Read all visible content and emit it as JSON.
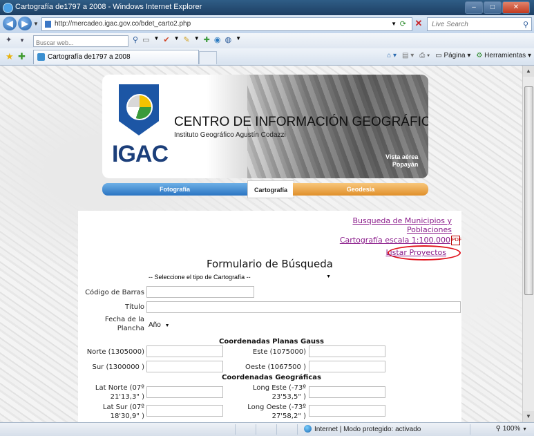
{
  "window": {
    "title": "Cartografía de1797 a 2008 - Windows Internet Explorer",
    "url": "http://mercadeo.igac.gov.co/bdet_carto2.php",
    "search_placeholder": "Live Search",
    "toolbar_search_placeholder": "Buscar web...",
    "tab_label": "Cartografía de1797 a 2008",
    "commands": {
      "pagina": "Página",
      "herramientas": "Herramientas"
    }
  },
  "banner": {
    "logo_text": "IGAC",
    "title": "CENTRO DE INFORMACIÓN GEOGRÁFICA",
    "subtitle": "Instituto Geográfico Agustín Codazzi",
    "aerial_caption_line1": "Vista aérea",
    "aerial_caption_line2": "Popayán"
  },
  "sections": {
    "fotografia": "Fotografía",
    "cartografia": "Cartografía",
    "geodesia": "Geodesia"
  },
  "links": {
    "busqueda": "Busqueda de Municipios y Poblaciones",
    "cartografia_escala": "Cartografía escala 1:100.000",
    "listar_proyectos": "Listar Proyectos"
  },
  "form": {
    "title": "Formulario de Búsqueda",
    "tipo_selected": "-- Seleccione el tipo de Cartografía --",
    "codigo_label": "Código de Barras",
    "titulo_label": "Título",
    "fecha_label": "Fecha de la Plancha",
    "year_value": "Año",
    "planas_header": "Coordenadas Planas Gauss",
    "norte_label": "Norte (1305000)",
    "este_label": "Este (1075000)",
    "sur_label": "Sur (1300000 )",
    "oeste_label": "Oeste (1067500 )",
    "geo_header": "Coordenadas Geográficas",
    "lat_norte_label": "Lat Norte (07º 21'13,3\" )",
    "long_este_label": "Long Este (-73º 23'53,5\" )",
    "lat_sur_label": "Lat Sur (07º 18'30,9\" )",
    "long_oeste_label": "Long Oeste (-73º 27'58,2\" )"
  },
  "status": {
    "zone": "Internet | Modo protegido: activado",
    "zoom": "100%"
  },
  "colors": {
    "link": "#8a1a8a",
    "highlight_circle": "#e0101a",
    "fotografia_tab": "#2a74c2",
    "geodesia_tab": "#e08f2a",
    "igac_blue": "#1c56a5"
  }
}
